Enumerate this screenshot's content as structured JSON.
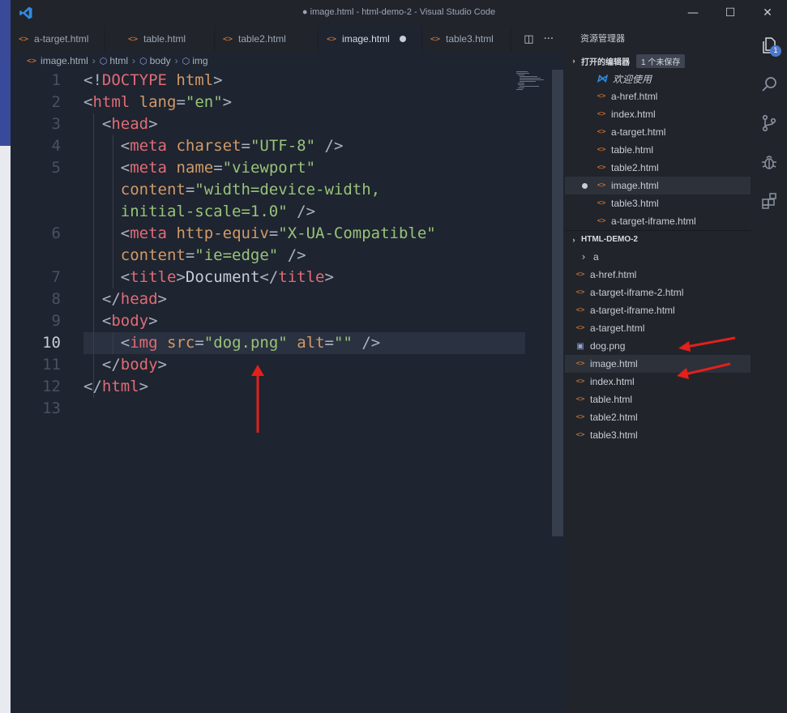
{
  "window": {
    "title": "● image.html - html-demo-2 - Visual Studio Code",
    "minimize_glyph": "—",
    "maximize_glyph": "☐",
    "close_glyph": "✕"
  },
  "tabs": [
    {
      "label": "a-target.html",
      "active": false,
      "dirty": false
    },
    {
      "label": "table.html",
      "active": false,
      "dirty": false
    },
    {
      "label": "table2.html",
      "active": false,
      "dirty": false
    },
    {
      "label": "image.html",
      "active": true,
      "dirty": true
    },
    {
      "label": "table3.html",
      "active": false,
      "dirty": false
    }
  ],
  "tab_actions": {
    "split_glyph": "◫",
    "more_glyph": "···"
  },
  "breadcrumb": [
    "image.html",
    "html",
    "body",
    "img"
  ],
  "editor": {
    "current_line": "10",
    "lines": [
      {
        "num": "1"
      },
      {
        "num": "2"
      },
      {
        "num": "3"
      },
      {
        "num": "4"
      },
      {
        "num": "5"
      },
      {
        "num": "6"
      },
      {
        "num": "7"
      },
      {
        "num": "8"
      },
      {
        "num": "9"
      },
      {
        "num": "10"
      },
      {
        "num": "11"
      },
      {
        "num": "12"
      },
      {
        "num": "13"
      }
    ],
    "code": {
      "l1_a": "<!",
      "l1_b": "DOCTYPE",
      "l1_c": " html",
      "l1_d": ">",
      "l2_tag": "html",
      "l2_attr": "lang",
      "l2_val": "\"en\"",
      "l3_tag": "head",
      "meta": "meta",
      "l4_attr": "charset",
      "l4_val": "\"UTF-8\"",
      "l5_attr": "name",
      "l5_val": "\"viewport\"",
      "l5b_attr": "content",
      "l5b_val": "\"width=device-width,",
      "l5c_val": "initial-scale=1.0\"",
      "l6_attr": "http-equiv",
      "l6_val": "\"X-UA-Compatible\"",
      "l6b_attr": "content",
      "l6b_val": "\"ie=edge\"",
      "l7_tag": "title",
      "l7_text": "Document",
      "l9_tag": "body",
      "l10_tag": "img",
      "l10_attr1": "src",
      "l10_val1": "\"dog.png\"",
      "l10_attr2": "alt",
      "l10_val2": "\"\""
    }
  },
  "explorer": {
    "title": "资源管理器",
    "open_editors": {
      "header": "打开的编辑器",
      "badge": "1 个未保存",
      "items": [
        {
          "label": "欢迎使用",
          "type": "welcome"
        },
        {
          "label": "a-href.html",
          "type": "html"
        },
        {
          "label": "index.html",
          "type": "html"
        },
        {
          "label": "a-target.html",
          "type": "html"
        },
        {
          "label": "table.html",
          "type": "html"
        },
        {
          "label": "table2.html",
          "type": "html"
        },
        {
          "label": "image.html",
          "type": "html",
          "dirty": true
        },
        {
          "label": "table3.html",
          "type": "html"
        },
        {
          "label": "a-target-iframe.html",
          "type": "html"
        }
      ]
    },
    "project": {
      "header": "HTML-DEMO-2",
      "items": [
        {
          "label": "a",
          "type": "folder"
        },
        {
          "label": "a-href.html",
          "type": "html"
        },
        {
          "label": "a-target-iframe-2.html",
          "type": "html"
        },
        {
          "label": "a-target-iframe.html",
          "type": "html"
        },
        {
          "label": "a-target.html",
          "type": "html"
        },
        {
          "label": "dog.png",
          "type": "image"
        },
        {
          "label": "image.html",
          "type": "html"
        },
        {
          "label": "index.html",
          "type": "html"
        },
        {
          "label": "table.html",
          "type": "html"
        },
        {
          "label": "table2.html",
          "type": "html"
        },
        {
          "label": "table3.html",
          "type": "html"
        }
      ]
    }
  },
  "activity_bar": {
    "items": [
      "files-icon",
      "search-icon",
      "source-control-icon",
      "debug-icon",
      "extensions-icon"
    ],
    "files_badge": "1"
  },
  "colors": {
    "annotation_arrow": "#e3201b",
    "accent": "#4d78cc",
    "html_icon": "#e37933"
  }
}
